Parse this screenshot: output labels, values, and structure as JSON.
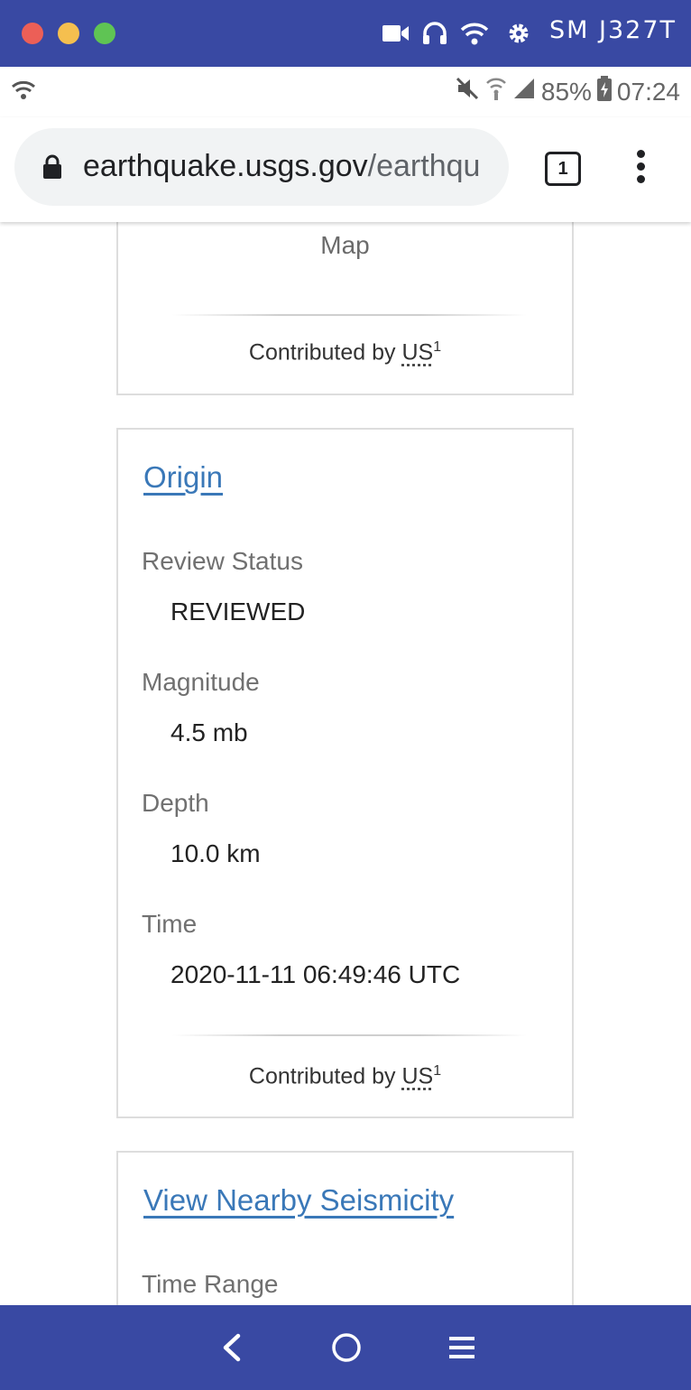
{
  "window": {
    "device_name": "SM J327T",
    "icons": [
      "video-camera-icon",
      "headphones-icon",
      "wifi-icon",
      "gear-icon"
    ]
  },
  "status_bar": {
    "battery": "85%",
    "time": "07:24"
  },
  "browser": {
    "url_host": "earthquake.usgs.gov",
    "url_path": "/earthqu",
    "tab_count": "1"
  },
  "map_card": {
    "label": "Map",
    "contributed_prefix": "Contributed by",
    "network": "US",
    "footnote": "1"
  },
  "origin_card": {
    "title": "Origin",
    "fields": [
      {
        "label": "Review Status",
        "value": "REVIEWED"
      },
      {
        "label": "Magnitude",
        "value": "4.5 mb"
      },
      {
        "label": "Depth",
        "value": "10.0 km"
      },
      {
        "label": "Time",
        "value": "2020-11-11 06:49:46 UTC"
      }
    ],
    "contributed_prefix": "Contributed by",
    "network": "US",
    "footnote": "1"
  },
  "seismicity_card": {
    "title": "View Nearby Seismicity",
    "field_label": "Time Range"
  },
  "colors": {
    "emulator_frame": "#3949a3",
    "link": "#3a78b8"
  }
}
